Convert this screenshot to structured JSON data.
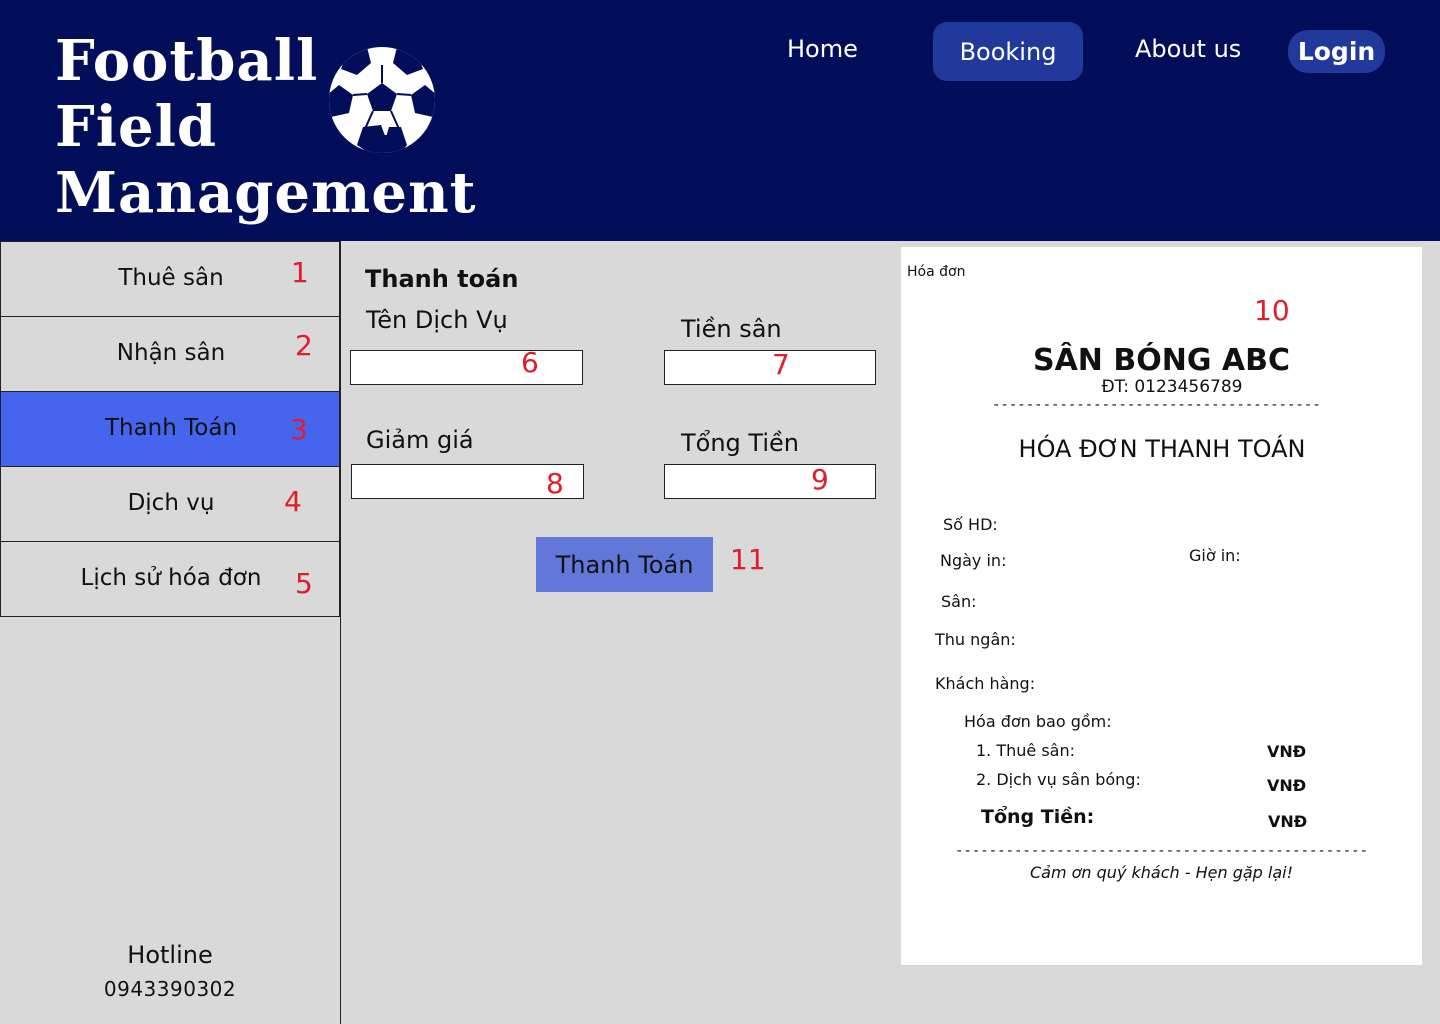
{
  "header": {
    "brand_lines": [
      "Football",
      "Field",
      "Management"
    ],
    "nav": {
      "home": "Home",
      "booking": "Booking",
      "about": "About us",
      "login": "Login"
    }
  },
  "sidebar": {
    "items": [
      {
        "label": "Thuê sân",
        "marker": "1"
      },
      {
        "label": "Nhận sân",
        "marker": "2"
      },
      {
        "label": "Thanh Toán",
        "marker": "3"
      },
      {
        "label": "Dịch vụ",
        "marker": "4"
      },
      {
        "label": "Lịch sử hóa đơn",
        "marker": "5"
      }
    ],
    "hotline_label": "Hotline",
    "hotline_number": "0943390302"
  },
  "payment": {
    "title": "Thanh toán",
    "fields": {
      "service_name": {
        "label": "Tên Dịch Vụ",
        "value": "",
        "marker": "6"
      },
      "field_price": {
        "label": "Tiền sân",
        "value": "",
        "marker": "7"
      },
      "discount": {
        "label": "Giảm giá",
        "value": "",
        "marker": "8"
      },
      "total": {
        "label": "Tổng Tiền",
        "value": "",
        "marker": "9"
      }
    },
    "button_label": "Thanh Toán",
    "button_marker": "11"
  },
  "invoice": {
    "caption": "Hóa đơn",
    "marker": "10",
    "shop_name": "SÂN BÓNG ABC",
    "phone": "ĐT: 0123456789",
    "divider": "-----------------------------------------------------------",
    "title": "HÓA ĐƠN THANH TOÁN",
    "invoice_no_label": "Số HD:",
    "print_date_label": "Ngày in:",
    "print_time_label": "Giờ in:",
    "field_label": "Sân:",
    "cashier_label": "Thu ngân:",
    "customer_label": "Khách hàng:",
    "includes_label": "Hóa đơn bao gồm:",
    "line_items": [
      {
        "label": "1. Thuê sân:",
        "currency": "VNĐ"
      },
      {
        "label": "2. Dịch vụ sân bóng:",
        "currency": "VNĐ"
      }
    ],
    "total_label": "Tổng Tiền:",
    "total_currency": "VNĐ",
    "footer_divider": "----------------------------------------------------------------------------",
    "thanks": "Cảm ơn quý khách - Hẹn gặp lại!"
  }
}
